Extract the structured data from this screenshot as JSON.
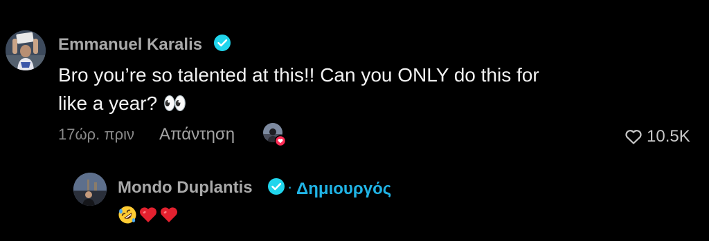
{
  "comment": {
    "author": "Emmanuel Karalis",
    "text": "Bro you’re so talented at this!! Can you ONLY do this for like a year? 👀",
    "text_line1": "Bro you’re so talented at this!! Can you ONLY do this for",
    "text_line2": "like a year? 👀",
    "timestamp": "17ώρ. πριν",
    "reply_label": "Απάντηση",
    "like_count": "10.5K",
    "verified_icon": "verified-check-icon",
    "like_icon": "heart-outline-icon",
    "creator_liked_icon": "creator-liked-avatar-icon"
  },
  "reply": {
    "author": "Mondo Duplantis",
    "separator": "·",
    "creator_label": "Δημιουργός",
    "content_emoji": [
      "rolling-on-floor-laughing-emoji",
      "red-heart-emoji",
      "red-heart-emoji"
    ],
    "verified_icon": "verified-check-icon"
  },
  "colors": {
    "background": "#000000",
    "username": "#a9a9a9",
    "comment_text": "#f2f2f2",
    "meta": "#8a8a8a",
    "verified_badge": "#20d5ec",
    "creator_label": "#20b4e6",
    "like_count": "#c8c8c8"
  }
}
